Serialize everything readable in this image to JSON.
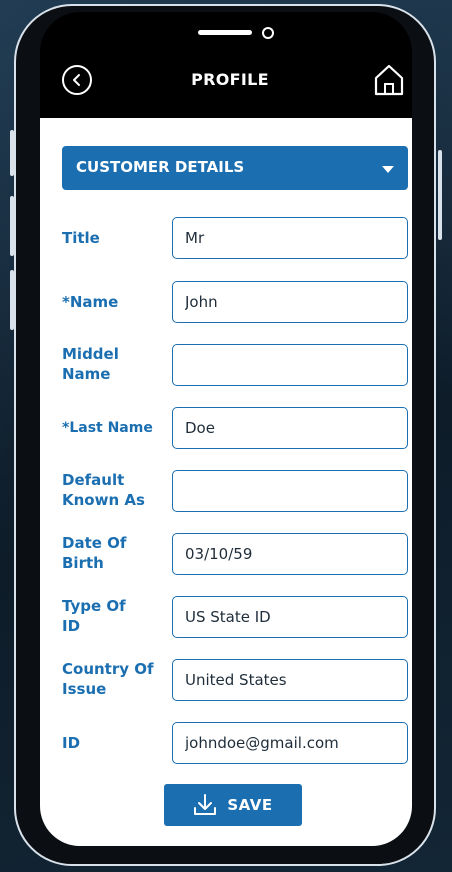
{
  "header": {
    "title": "PROFILE",
    "back_icon": "chevron-left-circle-icon",
    "home_icon": "home-icon"
  },
  "section": {
    "label": "CUSTOMER DETAILS",
    "caret_icon": "caret-down-icon"
  },
  "form": {
    "fields": [
      {
        "label": "Title",
        "value": "Mr"
      },
      {
        "label": "*Name",
        "value": "John"
      },
      {
        "label": "Middel Name",
        "value": ""
      },
      {
        "label": "*Last Name",
        "value": "Doe"
      },
      {
        "label": "Default Known As",
        "value": ""
      },
      {
        "label": "Date Of Birth",
        "value": "03/10/59"
      },
      {
        "label": "Type Of ID",
        "value": "US State ID"
      },
      {
        "label": "Country Of Issue",
        "value": "United States"
      },
      {
        "label": "ID",
        "value": "johndoe@gmail.com"
      }
    ]
  },
  "actions": {
    "save_label": "SAVE",
    "save_icon": "download-icon"
  },
  "colors": {
    "accent": "#1b6fb1",
    "header_bg": "#000000",
    "background": "#10202f"
  }
}
